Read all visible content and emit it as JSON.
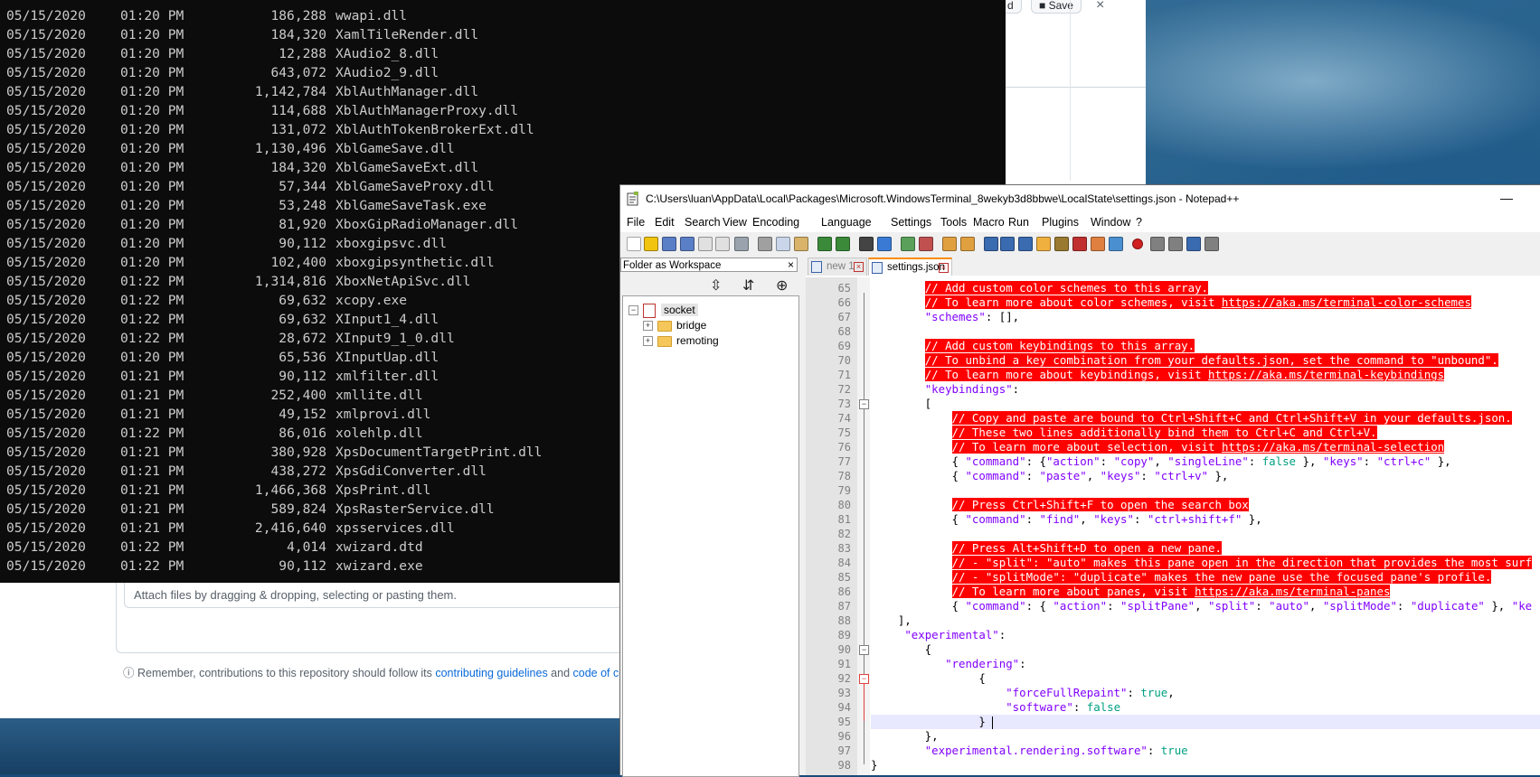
{
  "browser": {
    "top_buttons": [
      "d",
      "Save",
      "×"
    ],
    "attach_text": "Attach files by dragging & dropping, selecting or pasting them.",
    "note_prefix": "Remember, contributions to this repository should follow its ",
    "note_link1": "contributing guidelines",
    "note_mid": " and ",
    "note_link2": "code of con"
  },
  "terminal": {
    "rows": [
      {
        "date": "05/15/2020",
        "time": "01:20 PM",
        "size": "186,288",
        "name": "wwapi.dll"
      },
      {
        "date": "05/15/2020",
        "time": "01:20 PM",
        "size": "184,320",
        "name": "XamlTileRender.dll"
      },
      {
        "date": "05/15/2020",
        "time": "01:20 PM",
        "size": "12,288",
        "name": "XAudio2_8.dll"
      },
      {
        "date": "05/15/2020",
        "time": "01:20 PM",
        "size": "643,072",
        "name": "XAudio2_9.dll"
      },
      {
        "date": "05/15/2020",
        "time": "01:20 PM",
        "size": "1,142,784",
        "name": "XblAuthManager.dll"
      },
      {
        "date": "05/15/2020",
        "time": "01:20 PM",
        "size": "114,688",
        "name": "XblAuthManagerProxy.dll"
      },
      {
        "date": "05/15/2020",
        "time": "01:20 PM",
        "size": "131,072",
        "name": "XblAuthTokenBrokerExt.dll"
      },
      {
        "date": "05/15/2020",
        "time": "01:20 PM",
        "size": "1,130,496",
        "name": "XblGameSave.dll"
      },
      {
        "date": "05/15/2020",
        "time": "01:20 PM",
        "size": "184,320",
        "name": "XblGameSaveExt.dll"
      },
      {
        "date": "05/15/2020",
        "time": "01:20 PM",
        "size": "57,344",
        "name": "XblGameSaveProxy.dll"
      },
      {
        "date": "05/15/2020",
        "time": "01:20 PM",
        "size": "53,248",
        "name": "XblGameSaveTask.exe"
      },
      {
        "date": "05/15/2020",
        "time": "01:20 PM",
        "size": "81,920",
        "name": "XboxGipRadioManager.dll"
      },
      {
        "date": "05/15/2020",
        "time": "01:20 PM",
        "size": "90,112",
        "name": "xboxgipsvc.dll"
      },
      {
        "date": "05/15/2020",
        "time": "01:20 PM",
        "size": "102,400",
        "name": "xboxgipsynthetic.dll"
      },
      {
        "date": "05/15/2020",
        "time": "01:22 PM",
        "size": "1,314,816",
        "name": "XboxNetApiSvc.dll"
      },
      {
        "date": "05/15/2020",
        "time": "01:22 PM",
        "size": "69,632",
        "name": "xcopy.exe"
      },
      {
        "date": "05/15/2020",
        "time": "01:22 PM",
        "size": "69,632",
        "name": "XInput1_4.dll"
      },
      {
        "date": "05/15/2020",
        "time": "01:22 PM",
        "size": "28,672",
        "name": "XInput9_1_0.dll"
      },
      {
        "date": "05/15/2020",
        "time": "01:20 PM",
        "size": "65,536",
        "name": "XInputUap.dll"
      },
      {
        "date": "05/15/2020",
        "time": "01:21 PM",
        "size": "90,112",
        "name": "xmlfilter.dll"
      },
      {
        "date": "05/15/2020",
        "time": "01:21 PM",
        "size": "252,400",
        "name": "xmllite.dll"
      },
      {
        "date": "05/15/2020",
        "time": "01:21 PM",
        "size": "49,152",
        "name": "xmlprovi.dll"
      },
      {
        "date": "05/15/2020",
        "time": "01:22 PM",
        "size": "86,016",
        "name": "xolehlp.dll"
      },
      {
        "date": "05/15/2020",
        "time": "01:21 PM",
        "size": "380,928",
        "name": "XpsDocumentTargetPrint.dll"
      },
      {
        "date": "05/15/2020",
        "time": "01:21 PM",
        "size": "438,272",
        "name": "XpsGdiConverter.dll"
      },
      {
        "date": "05/15/2020",
        "time": "01:21 PM",
        "size": "1,466,368",
        "name": "XpsPrint.dll"
      },
      {
        "date": "05/15/2020",
        "time": "01:21 PM",
        "size": "589,824",
        "name": "XpsRasterService.dll"
      },
      {
        "date": "05/15/2020",
        "time": "01:21 PM",
        "size": "2,416,640",
        "name": "xpsservices.dll"
      },
      {
        "date": "05/15/2020",
        "time": "01:22 PM",
        "size": "4,014",
        "name": "xwizard.dtd"
      },
      {
        "date": "05/15/2020",
        "time": "01:22 PM",
        "size": "90,112",
        "name": "xwizard.exe"
      }
    ]
  },
  "npp": {
    "title": "C:\\Users\\luan\\AppData\\Local\\Packages\\Microsoft.WindowsTerminal_8wekyb3d8bbwe\\LocalState\\settings.json - Notepad++",
    "minimize": "—",
    "menu": [
      "File",
      "Edit",
      "Search",
      "View",
      "Encoding",
      "Language",
      "Settings",
      "Tools",
      "Macro",
      "Run",
      "Plugins",
      "Window",
      "?"
    ],
    "folder_panel": {
      "title": "Folder as Workspace",
      "close": "×",
      "tools": [
        "⇳",
        "⇵",
        "⊕"
      ],
      "root": "socket",
      "children": [
        "bridge",
        "remoting"
      ]
    },
    "tabs": [
      {
        "label": "new 1",
        "active": false
      },
      {
        "label": "settings.json",
        "active": true
      }
    ],
    "code_lines": [
      {
        "n": "65",
        "html": "        <span class='cmt'>// Add custom color schemes to this array.</span>"
      },
      {
        "n": "66",
        "html": "        <span class='cmt'>// To learn more about color schemes, visit <span class='url'>https://aka.ms/terminal-color-schemes</span></span>"
      },
      {
        "n": "67",
        "html": "        <span class='key'>\"schemes\"</span>: [],"
      },
      {
        "n": "68",
        "html": ""
      },
      {
        "n": "69",
        "html": "        <span class='cmt'>// Add custom keybindings to this array.</span>"
      },
      {
        "n": "70",
        "html": "        <span class='cmt'>// To unbind a key combination from your defaults.json, set the command to \"unbound\".</span>"
      },
      {
        "n": "71",
        "html": "        <span class='cmt'>// To learn more about keybindings, visit <span class='url'>https://aka.ms/terminal-keybindings</span></span>"
      },
      {
        "n": "72",
        "html": "        <span class='key'>\"keybindings\"</span>:"
      },
      {
        "n": "73",
        "html": "        ["
      },
      {
        "n": "74",
        "html": "            <span class='cmt'>// Copy and paste are bound to Ctrl+Shift+C and Ctrl+Shift+V in your defaults.json.</span>"
      },
      {
        "n": "75",
        "html": "            <span class='cmt'>// These two lines additionally bind them to Ctrl+C and Ctrl+V.</span>"
      },
      {
        "n": "76",
        "html": "            <span class='cmt'>// To learn more about selection, visit <span class='url'>https://aka.ms/terminal-selection</span></span>"
      },
      {
        "n": "77",
        "html": "            { <span class='key'>\"command\"</span>: {<span class='key'>\"action\"</span>: <span class='str'>\"copy\"</span>, <span class='key'>\"singleLine\"</span>: <span class='kw'>false</span> }, <span class='key'>\"keys\"</span>: <span class='str'>\"ctrl+c\"</span> },"
      },
      {
        "n": "78",
        "html": "            { <span class='key'>\"command\"</span>: <span class='str'>\"paste\"</span>, <span class='key'>\"keys\"</span>: <span class='str'>\"ctrl+v\"</span> },"
      },
      {
        "n": "79",
        "html": ""
      },
      {
        "n": "80",
        "html": "            <span class='cmt'>// Press Ctrl+Shift+F to open the search box</span>"
      },
      {
        "n": "81",
        "html": "            { <span class='key'>\"command\"</span>: <span class='str'>\"find\"</span>, <span class='key'>\"keys\"</span>: <span class='str'>\"ctrl+shift+f\"</span> },"
      },
      {
        "n": "82",
        "html": ""
      },
      {
        "n": "83",
        "html": "            <span class='cmt'>// Press Alt+Shift+D to open a new pane.</span>"
      },
      {
        "n": "84",
        "html": "            <span class='cmt'>// - \"split\": \"auto\" makes this pane open in the direction that provides the most surf</span>"
      },
      {
        "n": "85",
        "html": "            <span class='cmt'>// - \"splitMode\": \"duplicate\" makes the new pane use the focused pane's profile.</span>"
      },
      {
        "n": "86",
        "html": "            <span class='cmt'>// To learn more about panes, visit <span class='url'>https://aka.ms/terminal-panes</span></span>"
      },
      {
        "n": "87",
        "html": "            { <span class='key'>\"command\"</span>: { <span class='key'>\"action\"</span>: <span class='str'>\"splitPane\"</span>, <span class='key'>\"split\"</span>: <span class='str'>\"auto\"</span>, <span class='key'>\"splitMode\"</span>: <span class='str'>\"duplicate\"</span> }, <span class='key'>\"ke</span>"
      },
      {
        "n": "88",
        "html": "    ],"
      },
      {
        "n": "89",
        "html": "     <span class='key'>\"experimental\"</span>:"
      },
      {
        "n": "90",
        "html": "        {"
      },
      {
        "n": "91",
        "html": "           <span class='key'>\"rendering\"</span>:"
      },
      {
        "n": "92",
        "html": "                {"
      },
      {
        "n": "93",
        "html": "                    <span class='key'>\"forceFullRepaint\"</span>: <span class='kw'>true</span>,"
      },
      {
        "n": "94",
        "html": "                    <span class='key'>\"software\"</span>: <span class='kw'>false</span>"
      },
      {
        "n": "95",
        "html": "                } <span class='caret'></span>"
      },
      {
        "n": "96",
        "html": "        },"
      },
      {
        "n": "97",
        "html": "        <span class='key'>\"experimental.rendering.software\"</span>: <span class='kw'>true</span>"
      },
      {
        "n": "98",
        "html": "}"
      }
    ]
  },
  "colors": {
    "terminal_bg": "#0c0c0c",
    "comment_bg": "#ff0000",
    "key_color": "#8000ff",
    "bool_color": "#00a080"
  }
}
